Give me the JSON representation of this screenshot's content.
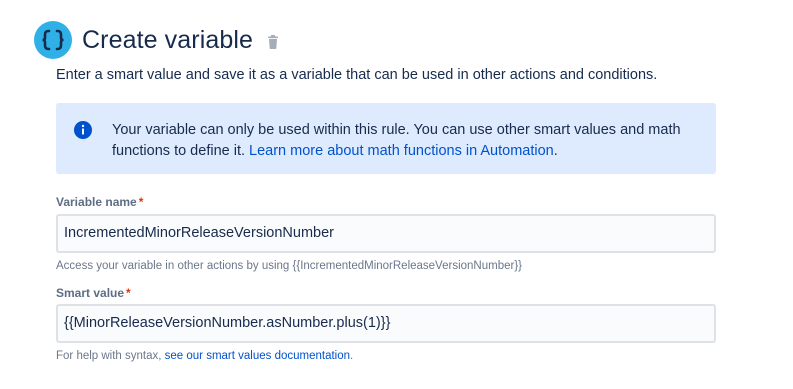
{
  "header": {
    "title": "Create variable",
    "logo_icon": "curly-braces-icon",
    "delete_icon": "trash-icon"
  },
  "description": "Enter a smart value and save it as a variable that can be used in other actions and conditions.",
  "info": {
    "icon": "info-icon",
    "text": "Your variable can only be used within this rule. You can use other smart values and math functions to define it. ",
    "link_text": "Learn more about math functions in Automation",
    "text_after": "."
  },
  "variable_name": {
    "label": "Variable name",
    "required_mark": "*",
    "value": "IncrementedMinorReleaseVersionNumber",
    "help": "Access your variable in other actions by using {{IncrementedMinorReleaseVersionNumber}}"
  },
  "smart_value": {
    "label": "Smart value",
    "required_mark": "*",
    "value": "{{MinorReleaseVersionNumber.asNumber.plus(1)}}",
    "help_prefix": "For help with syntax, ",
    "help_link": "see our smart values documentation",
    "help_suffix": "."
  },
  "colors": {
    "accent": "#0052cc",
    "info_bg": "#deebff",
    "logo_bg": "#2fb1e8",
    "required": "#de350b"
  }
}
